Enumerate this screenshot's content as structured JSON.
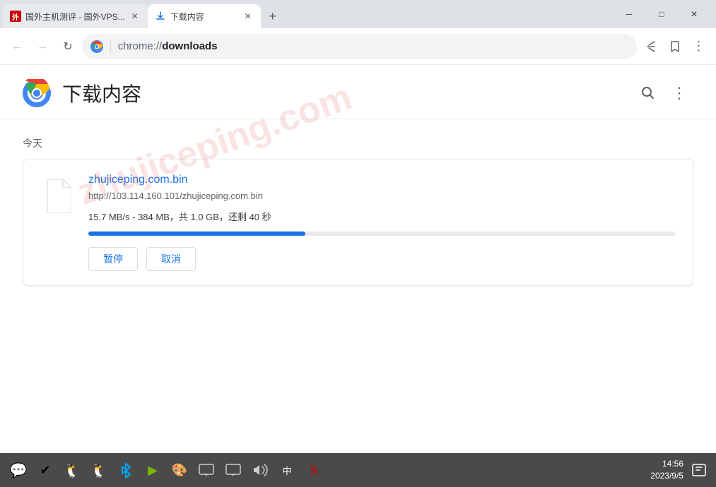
{
  "titlebar": {
    "tab1": {
      "title": "国外主机测评 - 国外VPS...",
      "active": false
    },
    "tab2": {
      "title": "下载内容",
      "active": true
    },
    "new_tab_label": "+"
  },
  "window_controls": {
    "minimize": "─",
    "maximize": "□",
    "close": "✕"
  },
  "toolbar": {
    "back_title": "Back",
    "forward_title": "Forward",
    "refresh_title": "Refresh",
    "address_brand": "Chrome",
    "address_separator": "|",
    "address_protocol": "chrome://",
    "address_path": "downloads",
    "share_title": "Share",
    "bookmark_title": "Bookmark",
    "more_title": "More"
  },
  "page": {
    "title": "下载内容",
    "search_title": "Search",
    "more_title": "More"
  },
  "watermark": "zhujiceping.com",
  "section": {
    "label": "今天"
  },
  "download": {
    "filename": "zhujiceping.com.bin",
    "url": "http://103.114.160.101/zhujiceping.com.bin",
    "status": "15.7 MB/s - 384 MB，共 1.0 GB，还剩 40 秒",
    "progress_percent": 37,
    "pause_label": "暂停",
    "cancel_label": "取消"
  },
  "taskbar": {
    "icons": [
      {
        "name": "wechat-icon",
        "glyph": "💬",
        "color": "#07C160"
      },
      {
        "name": "check-icon",
        "glyph": "✅"
      },
      {
        "name": "penguin-icon",
        "glyph": "🐧"
      },
      {
        "name": "penguin2-icon",
        "glyph": "🐧"
      },
      {
        "name": "bluetooth-icon",
        "glyph": "🔷"
      },
      {
        "name": "nvidia-icon",
        "glyph": "🟢"
      },
      {
        "name": "color-icon",
        "glyph": "🎨"
      },
      {
        "name": "display-icon",
        "glyph": "🖥"
      },
      {
        "name": "display2-icon",
        "glyph": "📺"
      },
      {
        "name": "volume-icon",
        "glyph": "🔊"
      },
      {
        "name": "lang-icon",
        "text": "中"
      },
      {
        "name": "wps-icon",
        "glyph": "🅂"
      },
      {
        "name": "chat-notify-icon",
        "glyph": "💬"
      }
    ],
    "time": "14:56",
    "date": "2023/9/5",
    "notification_icon": "🗨"
  }
}
